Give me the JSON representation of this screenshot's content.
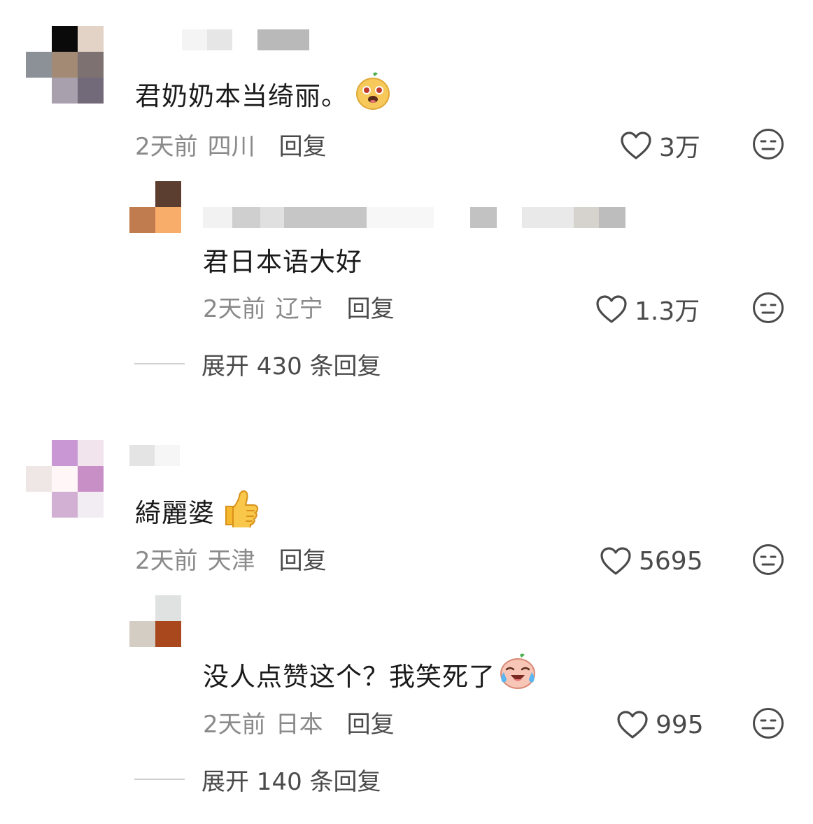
{
  "comments": [
    {
      "text": "君奶奶本当绮丽。",
      "emoji": "peanut-face-emoji",
      "time": "2天前",
      "location": "四川",
      "reply_label": "回复",
      "likes": "3万",
      "reply": {
        "text": "君日本语大好",
        "time": "2天前",
        "location": "辽宁",
        "reply_label": "回复",
        "likes": "1.3万"
      },
      "expand_label": "展开 430 条回复"
    },
    {
      "text": "綺麗婆",
      "emoji": "thumbs-up-emoji",
      "time": "2天前",
      "location": "天津",
      "reply_label": "回复",
      "likes": "5695",
      "reply": {
        "text": "没人点赞这个？我笑死了",
        "emoji": "laughing-crying-face-emoji",
        "time": "2天前",
        "location": "日本",
        "reply_label": "回复",
        "likes": "995"
      },
      "expand_label": "展开 140 条回复"
    }
  ],
  "colors": {
    "text": "#1a1a1a",
    "meta": "#8a8a8a",
    "action": "#4a4a4a"
  }
}
